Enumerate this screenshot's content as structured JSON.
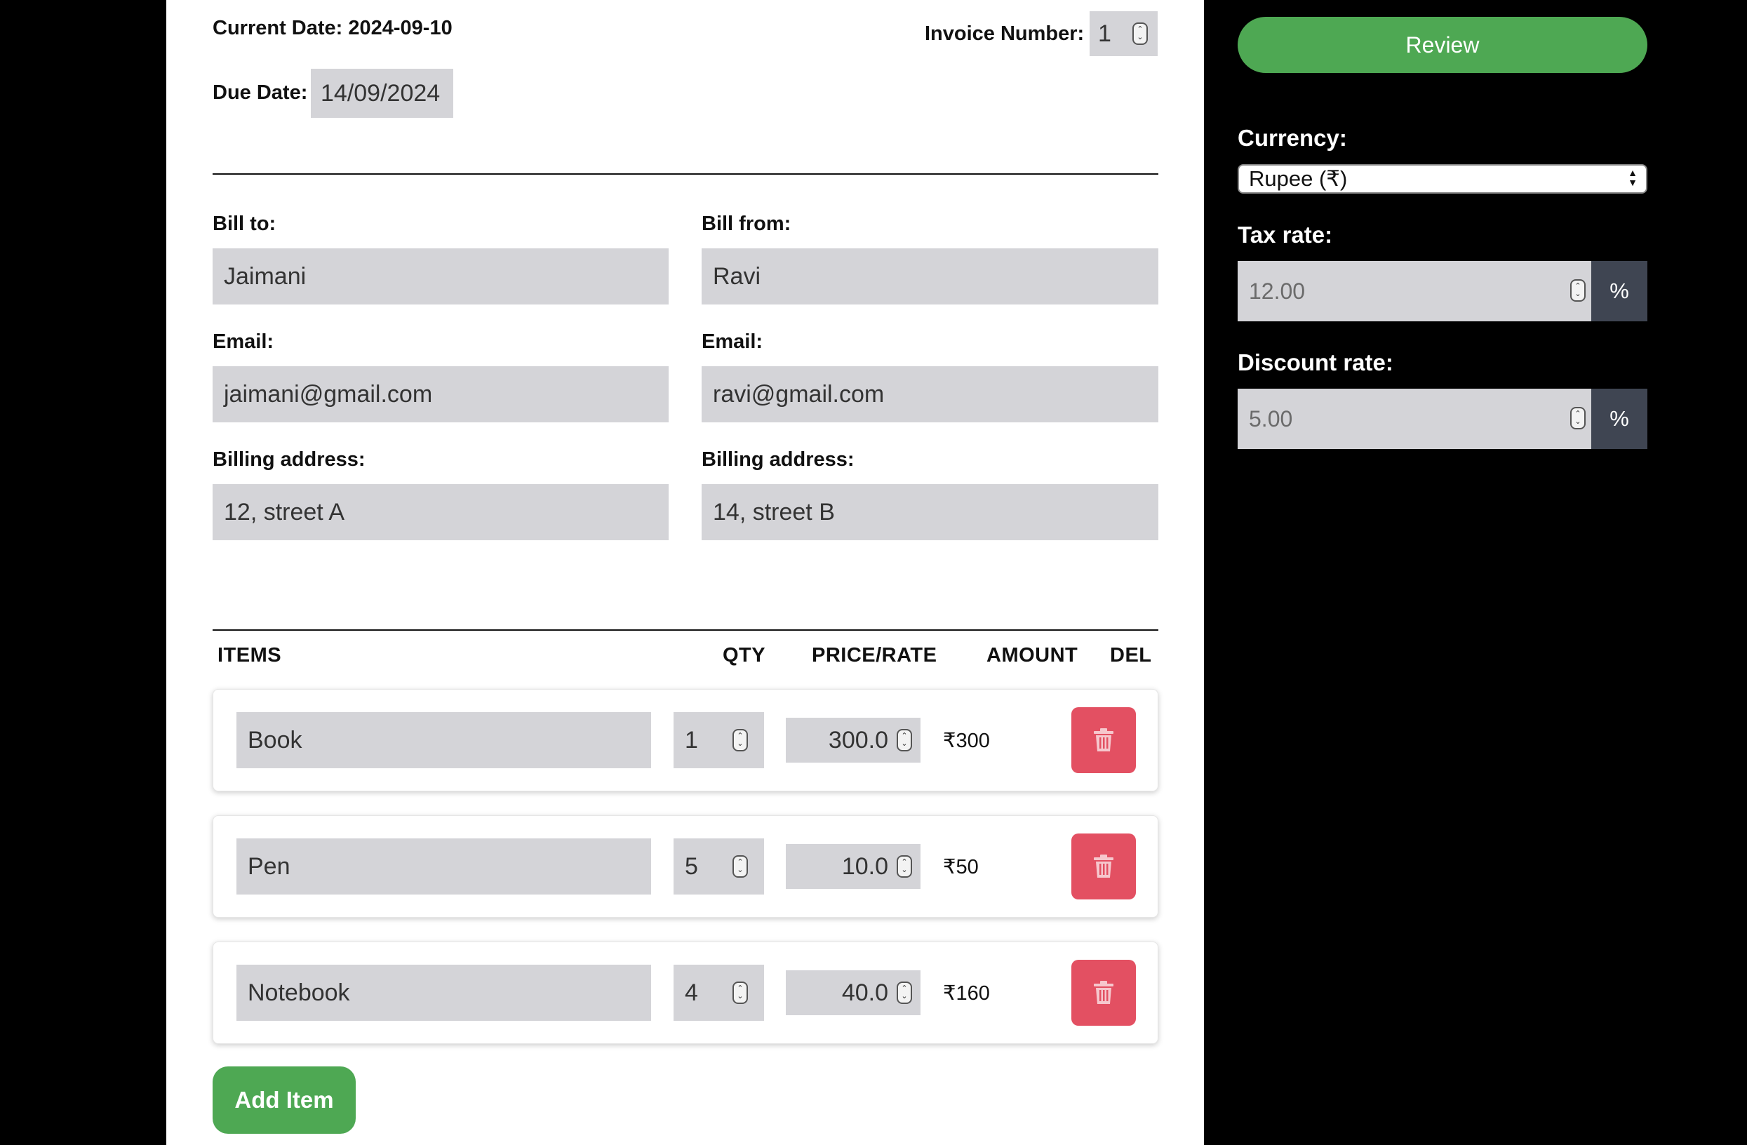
{
  "header": {
    "current_date_label": "Current Date:",
    "current_date_value": "2024-09-10",
    "invoice_number_label": "Invoice Number:",
    "invoice_number_value": "1",
    "due_date_label": "Due Date:",
    "due_date_value": "14/09/2024"
  },
  "bill_to": {
    "label": "Bill to:",
    "name": "Jaimani",
    "email_label": "Email:",
    "email": "jaimani@gmail.com",
    "address_label": "Billing address:",
    "address": "12, street A"
  },
  "bill_from": {
    "label": "Bill from:",
    "name": "Ravi",
    "email_label": "Email:",
    "email": "ravi@gmail.com",
    "address_label": "Billing address:",
    "address": "14, street B"
  },
  "items_table": {
    "headers": {
      "items": "ITEMS",
      "qty": "QTY",
      "price": "PRICE/RATE",
      "amount": "AMOUNT",
      "del": "DEL"
    },
    "rows": [
      {
        "name": "Book",
        "qty": "1",
        "price": "300.0",
        "amount": "₹300"
      },
      {
        "name": "Pen",
        "qty": "5",
        "price": "10.0",
        "amount": "₹50"
      },
      {
        "name": "Notebook",
        "qty": "4",
        "price": "40.0",
        "amount": "₹160"
      }
    ],
    "add_item_label": "Add Item"
  },
  "sidebar": {
    "review_label": "Review",
    "currency_label": "Currency:",
    "currency_value": "Rupee (₹)",
    "tax_label": "Tax rate:",
    "tax_value": "12.00",
    "discount_label": "Discount rate:",
    "discount_value": "5.00",
    "percent_symbol": "%"
  },
  "colors": {
    "accent_green": "#4ea853",
    "delete_red": "#e35062",
    "input_gray": "#d4d4d8",
    "percent_addon": "#3f4552"
  }
}
